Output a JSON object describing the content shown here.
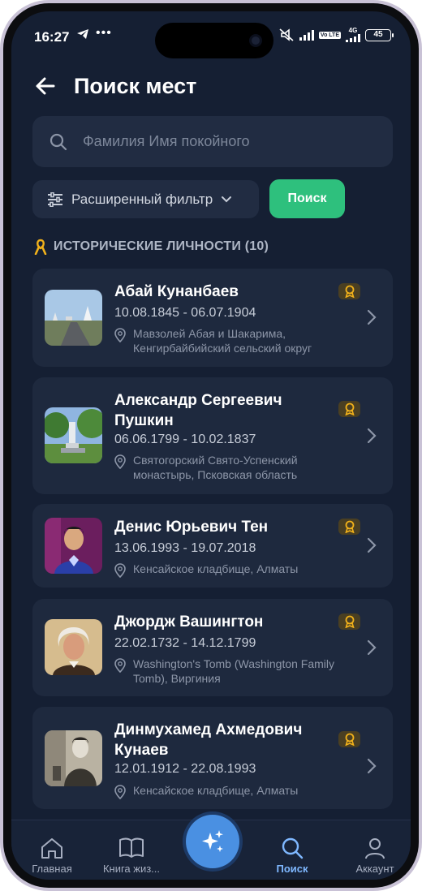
{
  "status_bar": {
    "time": "16:27",
    "network_label": "4G",
    "volte_label": "Vo LTE",
    "battery": "45"
  },
  "header": {
    "title": "Поиск мест"
  },
  "search": {
    "placeholder": "Фамилия Имя покойного",
    "value": "",
    "filter_label": "Расширенный фильтр",
    "submit_label": "Поиск"
  },
  "section": {
    "title": "ИСТОРИЧЕСКИЕ ЛИЧНОСТИ (10)"
  },
  "people": [
    {
      "name": "Абай Кунанбаев",
      "dates": "10.08.1845 - 06.07.1904",
      "location": "Мавзолей Абая и Шакарима, Кенгирбайбийский сельский округ"
    },
    {
      "name": "Александр Сергеевич Пушкин",
      "dates": "06.06.1799 - 10.02.1837",
      "location": "Святогорский Свято-Успенский монастырь, Псковская область"
    },
    {
      "name": "Денис Юрьевич Тен",
      "dates": "13.06.1993 - 19.07.2018",
      "location": "Кенсайское кладбище, Алматы"
    },
    {
      "name": "Джордж Вашингтон",
      "dates": "22.02.1732 - 14.12.1799",
      "location": "Washington's Tomb (Washington Family Tomb), Виргиния"
    },
    {
      "name": "Динмухамед Ахмедович Кунаев",
      "dates": "12.01.1912 - 22.08.1993",
      "location": "Кенсайское кладбище, Алматы"
    }
  ],
  "nav": {
    "home": "Главная",
    "book": "Книга жиз...",
    "search": "Поиск",
    "account": "Аккаунт"
  },
  "colors": {
    "background": "#151f33",
    "card": "#1e293e",
    "accent_green": "#2ec07d",
    "accent_blue": "#4a90e2",
    "badge": "#4a3f22"
  },
  "icons": {
    "back": "arrow-left-icon",
    "search": "search-icon",
    "filter": "sliders-icon",
    "section": "ribbon-icon",
    "badge": "medal-icon",
    "location": "map-pin-icon",
    "home": "home-icon",
    "book": "book-icon",
    "fab": "sparkles-icon",
    "account": "user-icon"
  }
}
